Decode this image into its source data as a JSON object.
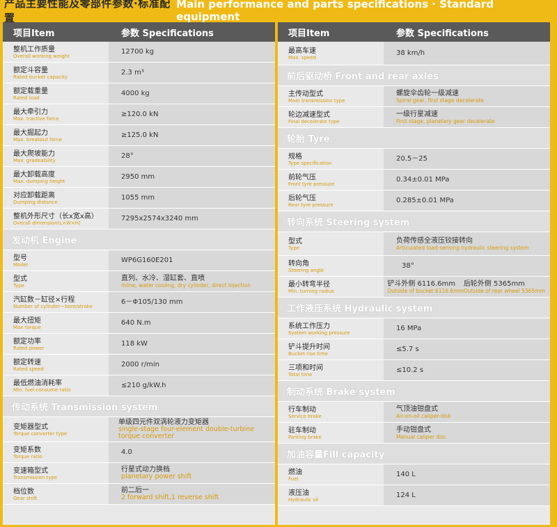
{
  "banner": {
    "cn_title": "产品主要性能及零部件参数·标准配置",
    "en_title": "Main performance and parts specifications · Standard equipment"
  },
  "header": {
    "item": "项目Item",
    "spec": "参数 Specifications"
  },
  "left": {
    "general": [
      {
        "cn": "整机工作质量",
        "en": "Overall working weight",
        "value": "12700 kg"
      },
      {
        "cn": "额定斗容量",
        "en": "Rated bucket capacity",
        "value": "2.3 m³"
      },
      {
        "cn": "额定载重量",
        "en": "Rated load",
        "value": "4000 kg"
      },
      {
        "cn": "最大牵引力",
        "en": "Max. tractive force",
        "value": "≥120.0 kN"
      },
      {
        "cn": "最大掘起力",
        "en": "Max. breakout force",
        "value": "≥125.0 kN"
      },
      {
        "cn": "最大爬坡能力",
        "en": "Max. gradeability",
        "value": "28°"
      },
      {
        "cn": "最大卸载高度",
        "en": "Max. dumping height",
        "value": "2950 mm"
      },
      {
        "cn": "对应卸载距离",
        "en": "Dumping distance",
        "value": "1055 mm"
      },
      {
        "cn": "整机外形尺寸（长x宽x高）",
        "en": "Overall dimension(L×W×H)",
        "value": "7295x2574x3240 mm"
      }
    ],
    "engine_title": "发动机 Engine",
    "engine": [
      {
        "cn": "型号",
        "en": "Model",
        "value": "WP6G160E201",
        "sub": ""
      },
      {
        "cn": "型式",
        "en": "Type",
        "value": "直列、水冷、湿缸套、直喷",
        "sub": "Inline, water cooling, dry cylinder, direct injection"
      },
      {
        "cn": "汽缸数－缸径×行程",
        "en": "Number of cylinder－bore/stroke",
        "value": "6－Φ105/130 mm",
        "sub": ""
      },
      {
        "cn": "最大扭矩",
        "en": "Max torque",
        "value": "640 N.m",
        "sub": ""
      },
      {
        "cn": "额定功率",
        "en": "Rated power",
        "value": "118 kW",
        "sub": ""
      },
      {
        "cn": "额定转速",
        "en": "Rated speed",
        "value": "2000 r/min",
        "sub": ""
      },
      {
        "cn": "最低燃油消耗率",
        "en": "Min. fuel-consume ratio",
        "value": "≤210 g/kW.h",
        "sub": ""
      }
    ],
    "transmission_title": "传动系统 Transmission system",
    "transmission": [
      {
        "cn": "变矩器型式",
        "en": "Torque converter type",
        "value": "单级四元件双涡轮液力变矩器",
        "sub": "single-stage four-element double-turbine torque converter"
      },
      {
        "cn": "变矩系数",
        "en": "Torque ratio",
        "value": "4.0",
        "sub": ""
      },
      {
        "cn": "变速箱型式",
        "en": "Transmission type",
        "value": "行星式动力换档",
        "sub": "planetary power shift"
      },
      {
        "cn": "档位数",
        "en": "Gear shift",
        "value": "前二后一",
        "sub": "2 forward shift,1 reverse shift"
      }
    ]
  },
  "right": {
    "general": [
      {
        "cn": "最高车速",
        "en": "Max. speed",
        "value": "38 km/h"
      }
    ],
    "axles_title": "前后驱动桥 Front and rear axles",
    "axles": [
      {
        "cn": "主传动型式",
        "en": "Main transmission type",
        "value": "螺旋伞齿轮一级减速",
        "sub": "Spiral gear, first stage decelerate"
      },
      {
        "cn": "轮边减速型式",
        "en": "Final decelerate type",
        "value": "一级行星减速",
        "sub": "First stage, planetary gear decelerate"
      }
    ],
    "tyre_title": "轮胎 Tyre",
    "tyre": [
      {
        "cn": "规格",
        "en": "Type specification",
        "value": "20.5－25"
      },
      {
        "cn": "前轮气压",
        "en": "Front tyre pressure",
        "value": "0.34±0.01 MPa"
      },
      {
        "cn": "后轮气压",
        "en": "Rear tyre pressure",
        "value": "0.285±0.01 MPa"
      }
    ],
    "steering_title": "转向系统 Steering system",
    "steering": {
      "type": {
        "cn": "型式",
        "en": "Type",
        "value": "负荷传感全液压铰接转向",
        "sub": "Articulated load-sensing hydraulic steering system"
      },
      "angle": {
        "cn": "转向角",
        "en": "Steering angle",
        "value": "38°"
      },
      "radius": {
        "cn": "最小转弯半径",
        "en": "Min. turning radius",
        "bucket_value": "铲斗外侧 6116.6mm",
        "bucket_sub": "Outside of bucket 6116.6mm",
        "wheel_value": "后轮外侧 5365mm",
        "wheel_sub": "Outside of rear wheel 5365mm"
      }
    },
    "hydraulic_title": "工作液压系统 Hydraulic system",
    "hydraulic": [
      {
        "cn": "系统工作压力",
        "en": "System working pressure",
        "value": "16 MPa"
      },
      {
        "cn": "铲斗提升时间",
        "en": "Bucket rise time",
        "value": "≤5.7 s"
      },
      {
        "cn": "三项和时间",
        "en": "Total time",
        "value": "≤10.2 s"
      }
    ],
    "brake_title": "制动系统 Brake system",
    "brake": [
      {
        "cn": "行车制动",
        "en": "Service brake",
        "value": "气顶油钳盘式",
        "sub": "Air-on-oil caliper-disk"
      },
      {
        "cn": "驻车制动",
        "en": "Parking brake",
        "value": "手动钳盘式",
        "sub": "Manual caliper disc"
      }
    ],
    "fill_title": "加油容量Fill capacity",
    "fill": [
      {
        "cn": "燃油",
        "en": "Fuel",
        "value": "140 L"
      },
      {
        "cn": "液压油",
        "en": "Hydraulic oil",
        "value": "124 L"
      }
    ]
  }
}
